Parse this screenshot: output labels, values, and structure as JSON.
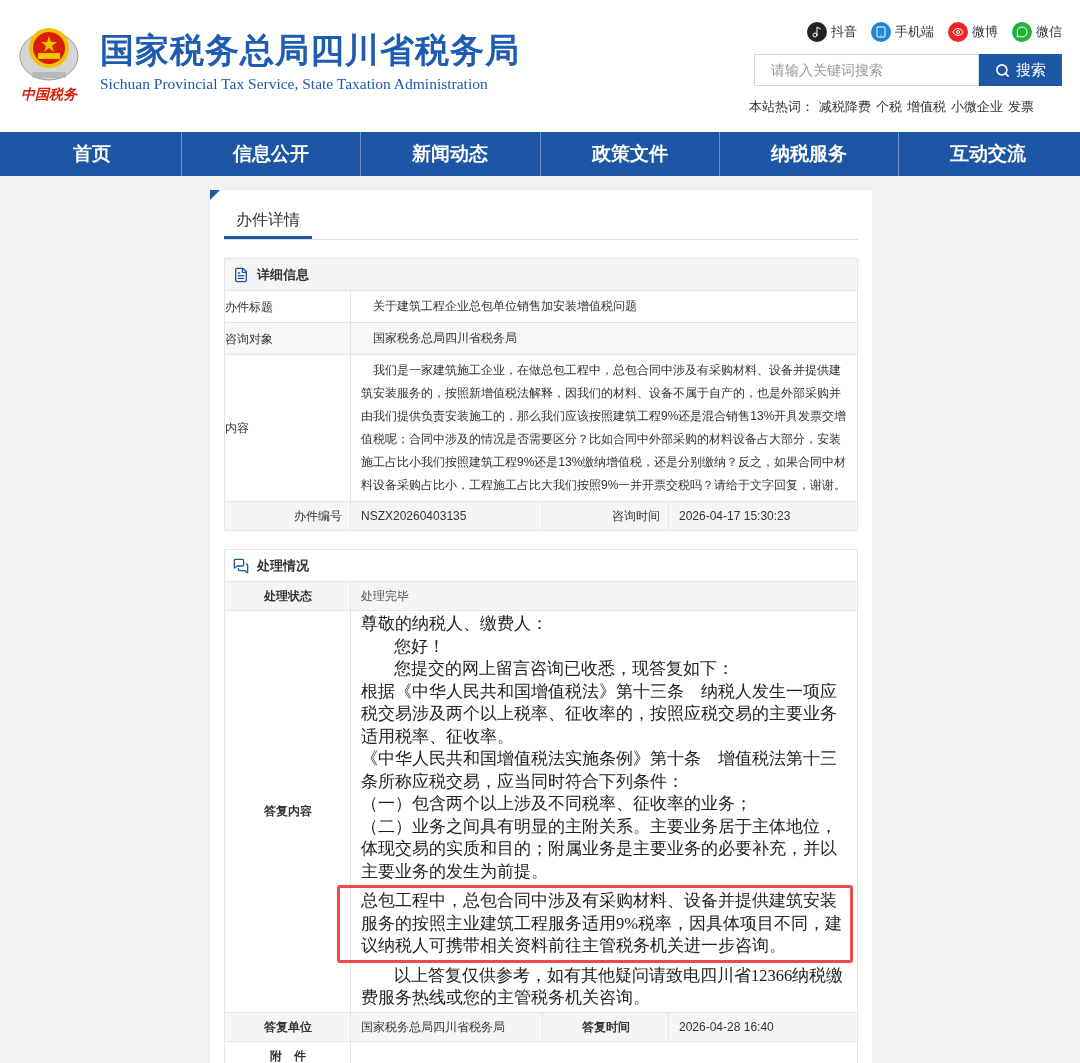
{
  "header": {
    "logo_caption": "中国税务",
    "title": "国家税务总局四川省税务局",
    "subtitle": "Sichuan Provincial Tax Service, State Taxation Administration",
    "social": [
      {
        "kind": "tiktok",
        "label": "抖音"
      },
      {
        "kind": "mobile",
        "label": "手机端"
      },
      {
        "kind": "weibo",
        "label": "微博"
      },
      {
        "kind": "wechat",
        "label": "微信"
      }
    ],
    "search": {
      "placeholder": "请输入关键词搜索",
      "button": "搜索"
    },
    "hot_label": "本站热词：",
    "hot_words": [
      "减税降费",
      "个税",
      "增值税",
      "小微企业",
      "发票"
    ]
  },
  "nav": [
    {
      "label": "首页"
    },
    {
      "label": "信息公开"
    },
    {
      "label": "新闻动态"
    },
    {
      "label": "政策文件"
    },
    {
      "label": "纳税服务"
    },
    {
      "label": "互动交流"
    }
  ],
  "tab": {
    "label": "办件详情",
    "selected": true
  },
  "detail": {
    "title": "详细信息",
    "rows": [
      {
        "label": "办件标题",
        "value": "关于建筑工程企业总包单位销售加安装增值税问题"
      },
      {
        "label": "咨询对象",
        "value": "国家税务总局四川省税务局"
      },
      {
        "label": "内容",
        "value": "我们是一家建筑施工企业，在做总包工程中，总包合同中涉及有采购材料、设备并提供建筑安装服务的，按照新增值税法解释，因我们的材料、设备不属于自产的，也是外部采购并由我们提供负责安装施工的，那么我们应该按照建筑工程9%还是混合销售13%开具发票交增值税呢；合同中涉及的情况是否需要区分？比如合同中外部采购的材料设备占大部分，安装施工占比小我们按照建筑工程9%还是13%缴纳增值税，还是分别缴纳？反之，如果合同中材料设备采购占比小，工程施工占比大我们按照9%一并开票交税吗？请给于文字回复，谢谢。"
      }
    ],
    "number_label": "办件编号",
    "number": "NSZX20260403135",
    "time_label": "咨询时间",
    "time": "2026-04-17 15:30:23"
  },
  "handling": {
    "title": "处理情况",
    "status_label": "处理状态",
    "status": "处理完毕",
    "reply_label": "答复内容",
    "reply": [
      {
        "kind": "plain",
        "text": "尊敬的纳税人、缴费人："
      },
      {
        "kind": "indent",
        "text": "您好！"
      },
      {
        "kind": "indent",
        "text": "您提交的网上留言咨询已收悉，现答复如下："
      },
      {
        "kind": "plain",
        "text": "根据《中华人民共和国增值税法》第十三条　纳税人发生一项应税交易涉及两个以上税率、征收率的，按照应税交易的主要业务适用税率、征收率。"
      },
      {
        "kind": "plain",
        "text": "《中华人民共和国增值税法实施条例》第十条　增值税法第十三条所称应税交易，应当同时符合下列条件："
      },
      {
        "kind": "plain",
        "text": "（一）包含两个以上涉及不同税率、征收率的业务；"
      },
      {
        "kind": "plain",
        "text": "（二）业务之间具有明显的主附关系。主要业务居于主体地位，体现交易的实质和目的；附属业务是主要业务的必要补充，并以主要业务的发生为前提。"
      },
      {
        "kind": "highlight",
        "text": "总包工程中，总包合同中涉及有采购材料、设备并提供建筑安装服务的按照主业建筑工程服务适用9%税率，因具体项目不同，建议纳税人可携带相关资料前往主管税务机关进一步咨询。"
      },
      {
        "kind": "indent",
        "text": "以上答复仅供参考，如有其他疑问请致电四川省12366纳税缴费服务热线或您的主管税务机关咨询。"
      }
    ],
    "unit_label": "答复单位",
    "unit": "国家税务总局四川省税务局",
    "reply_time_label": "答复时间",
    "reply_time": "2026-04-28 16:40",
    "attachment_label": "附　件"
  }
}
